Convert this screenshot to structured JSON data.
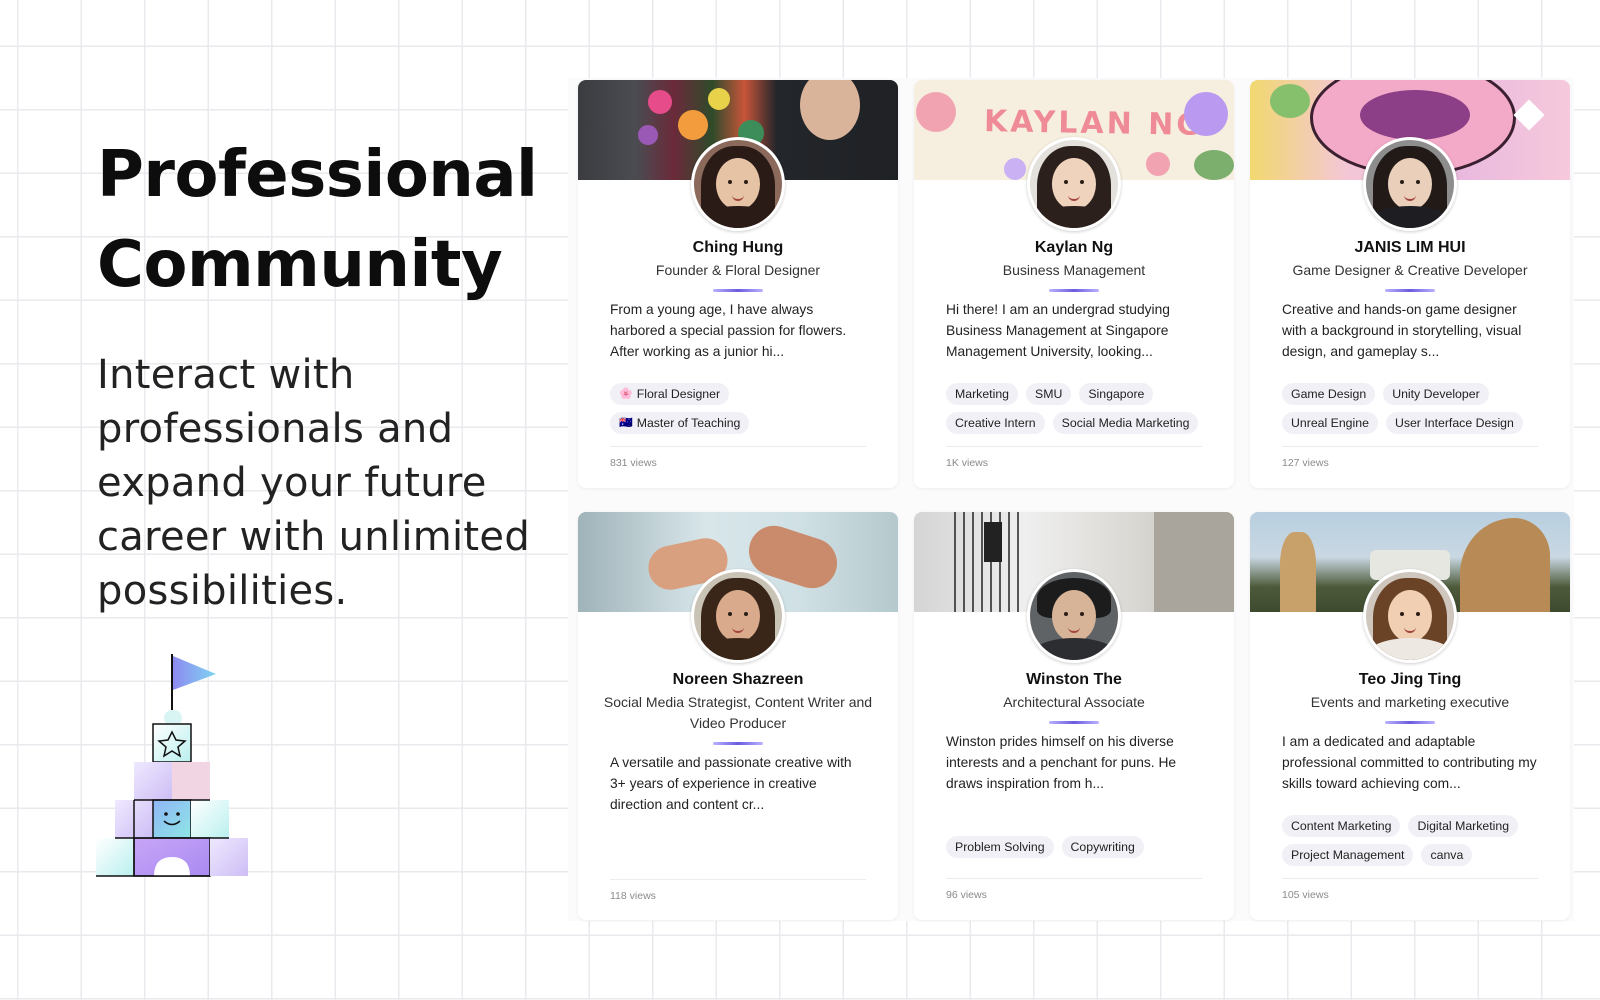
{
  "hero": {
    "title_line1": "Professional",
    "title_line2": "Community",
    "subtitle": "Interact with professionals and expand your future career with unlimited possibilities."
  },
  "cards": [
    {
      "name": "Ching Hung",
      "role": "Founder & Floral Designer",
      "bio": "From a young age, I have always harbored a special passion for flowers. After working as a junior hi...",
      "tags": [
        {
          "icon": "🌸",
          "label": "Floral Designer"
        },
        {
          "icon": "🇦🇺",
          "label": "Master of Teaching"
        }
      ],
      "views": "831 views"
    },
    {
      "name": "Kaylan Ng",
      "role": "Business Management",
      "cover_text": "KAYLAN NG",
      "bio": "Hi there! I am an undergrad studying Business Management at Singapore Management University, looking...",
      "tags": [
        {
          "label": "Marketing"
        },
        {
          "label": "SMU"
        },
        {
          "label": "Singapore"
        },
        {
          "label": "Creative Intern"
        },
        {
          "label": "Social Media Marketing"
        }
      ],
      "views": "1K views"
    },
    {
      "name": "JANIS LIM HUI",
      "role": "Game Designer & Creative Developer",
      "bio": "Creative and hands-on game designer with a background in storytelling, visual design, and gameplay s...",
      "tags": [
        {
          "label": "Game Design"
        },
        {
          "label": "Unity Developer"
        },
        {
          "label": "Unreal Engine"
        },
        {
          "label": "User Interface Design"
        }
      ],
      "views": "127 views"
    },
    {
      "name": "Noreen Shazreen",
      "role": "Social Media Strategist, Content Writer and Video Producer",
      "bio": "A versatile and passionate creative with 3+ years of experience in creative direction and content cr...",
      "tags": [],
      "views": "118 views"
    },
    {
      "name": "Winston The",
      "role": "Architectural Associate",
      "bio": "Winston prides himself on his diverse interests and a penchant for puns. He draws inspiration from h...",
      "tags": [
        {
          "label": "Problem Solving"
        },
        {
          "label": "Copywriting"
        }
      ],
      "views": "96 views"
    },
    {
      "name": "Teo Jing Ting",
      "role": "Events and marketing executive",
      "bio": "I am a dedicated and adaptable professional committed to contributing my skills toward achieving com...",
      "tags": [
        {
          "label": "Content Marketing"
        },
        {
          "label": "Digital Marketing"
        },
        {
          "label": "Project Management"
        },
        {
          "label": "canva"
        }
      ],
      "views": "105 views"
    }
  ]
}
